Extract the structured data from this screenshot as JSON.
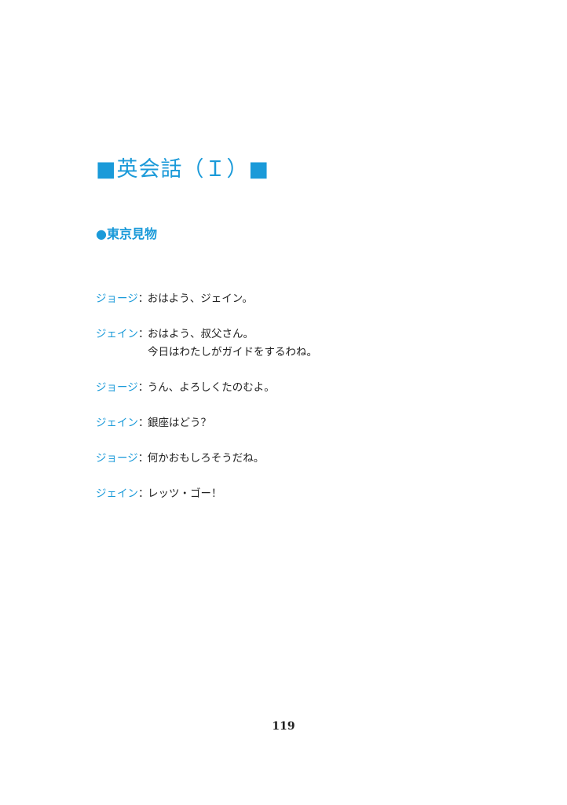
{
  "title": "■英会話（Ｉ）■",
  "section_heading": "●東京見物",
  "dialogue": [
    {
      "speaker": "ジョージ",
      "colon": "：",
      "lines": [
        "おはよう、ジェイン。"
      ]
    },
    {
      "speaker": "ジェイン",
      "colon": "：",
      "lines": [
        "おはよう、叔父さん。",
        "今日はわたしがガイドをするわね。"
      ]
    },
    {
      "speaker": "ジョージ",
      "colon": "：",
      "lines": [
        "うん、よろしくたのむよ。"
      ]
    },
    {
      "speaker": "ジェイン",
      "colon": "：",
      "lines": [
        "銀座はどう？"
      ]
    },
    {
      "speaker": "ジョージ",
      "colon": "：",
      "lines": [
        "何かおもしろそうだね。"
      ]
    },
    {
      "speaker": "ジェイン",
      "colon": "：",
      "lines": [
        "レッツ・ゴー！"
      ]
    }
  ],
  "page_number": "119",
  "colors": {
    "accent": "#1a9ad9",
    "text": "#222222",
    "background": "#ffffff"
  }
}
